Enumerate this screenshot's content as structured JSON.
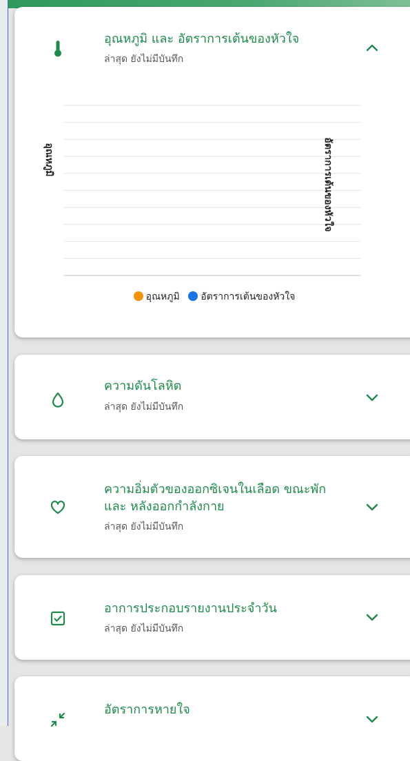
{
  "colors": {
    "accent": "#1e8a4c",
    "temperature_series": "#f5920a",
    "heart_rate_series": "#1a73e8"
  },
  "cards": [
    {
      "title": "อุณหภูมิ และ อัตราการเต้นของหัวใจ",
      "subtitle": "ล่าสุด ยังไม่มีบันทึก",
      "icon": "thermometer-icon",
      "expanded": true
    },
    {
      "title": "ความดันโลหิต",
      "subtitle": "ล่าสุด ยังไม่มีบันทึก",
      "icon": "droplet-icon",
      "expanded": false
    },
    {
      "title_line1": "ความอิ่มตัวของออกซิเจนในเลือด ขณะพัก",
      "title_line2": "และ หลังออกกำลังกาย",
      "subtitle": "ล่าสุด ยังไม่มีบันทึก",
      "icon": "heart-icon",
      "expanded": false
    },
    {
      "title": "อาการประกอบรายงานประจำวัน",
      "subtitle": "ล่าสุด ยังไม่มีบันทึก",
      "icon": "checkbox-icon",
      "expanded": false
    },
    {
      "title": "อัตราการหายใจ",
      "icon": "compress-arrows-icon",
      "expanded": false
    }
  ],
  "chart_data": {
    "type": "line",
    "x": [],
    "series": [
      {
        "name": "อุณหภูมิ",
        "values": []
      },
      {
        "name": "อัตราการเต้นของหัวใจ",
        "values": []
      }
    ],
    "ylabel": "อุณหภูมิ",
    "y2label": "อัตราการเต้นของหัวใจ",
    "grid": true,
    "gridline_count": 11,
    "legend_position": "bottom"
  }
}
